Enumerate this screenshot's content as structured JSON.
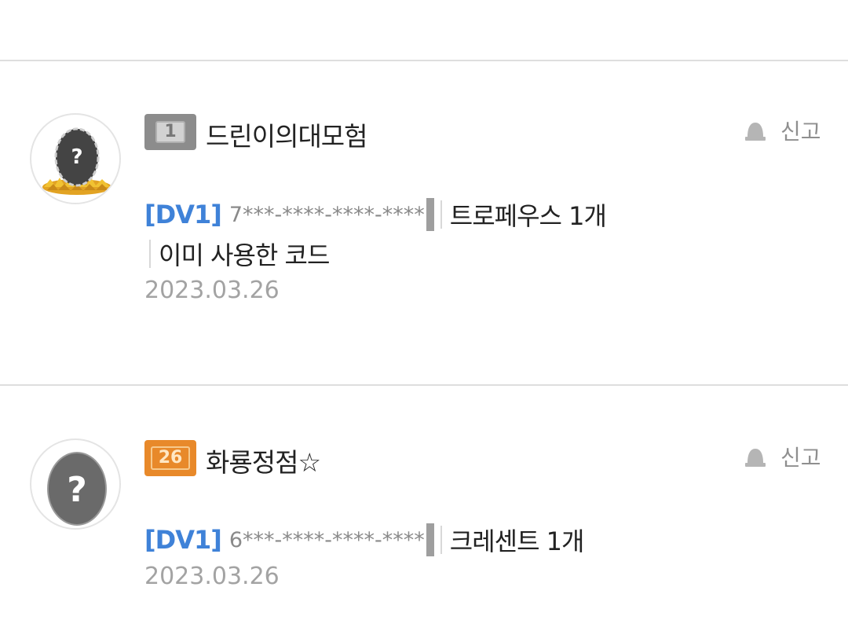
{
  "comments": [
    {
      "level": "1",
      "level_color": "#8c8c8c",
      "nickname": "드린이의대모험",
      "report_label": "신고",
      "tag": "[DV1]",
      "code": "7***-****-****-****",
      "reward": "트로페우스 1개",
      "note": "이미 사용한 코드",
      "date": "2023.03.26",
      "avatar_icon": "egg-on-nest-icon"
    },
    {
      "level": "26",
      "level_color": "#e8892a",
      "nickname": "화룡정점☆",
      "report_label": "신고",
      "tag": "[DV1]",
      "code": "6***-****-****-****",
      "reward": "크레센트 1개",
      "date": "2023.03.26",
      "avatar_icon": "grey-egg-icon"
    }
  ],
  "colors": {
    "tag": "#3f82d8",
    "divider": "#dedede",
    "muted": "#a3a3a3"
  }
}
